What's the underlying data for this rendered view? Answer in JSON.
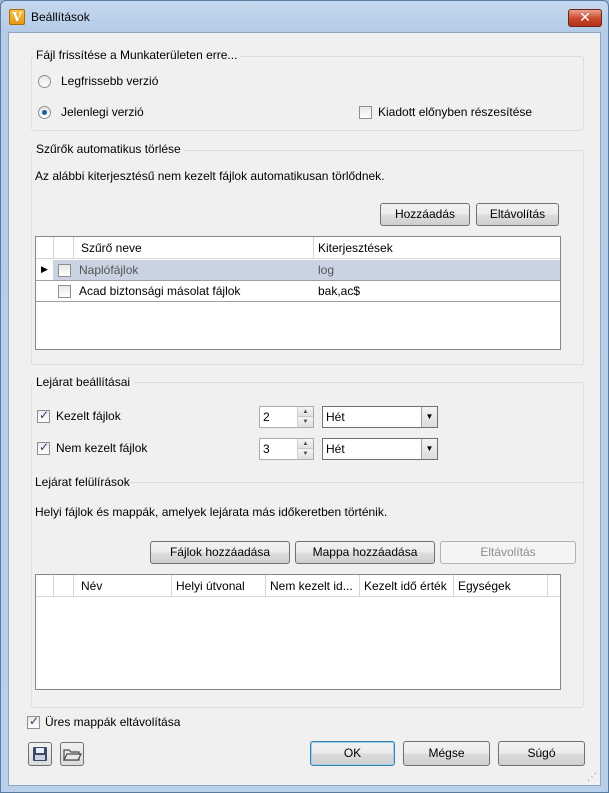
{
  "window": {
    "title": "Beállítások",
    "app_icon_letter": "V",
    "close_glyph": "✕"
  },
  "refresh": {
    "group_label": "Fájl frissítése a Munkaterületen erre...",
    "latest_label": "Legfrissebb verzió",
    "current_label": "Jelenlegi verzió",
    "prefer_released_label": "Kiadott előnyben részesítése",
    "selected": "current"
  },
  "auto_delete": {
    "group_label": "Szűrők automatikus törlése",
    "description": "Az alábbi kiterjesztésű nem kezelt fájlok automatikusan törlődnek.",
    "add_button": "Hozzáadás",
    "remove_button": "Eltávolítás",
    "columns": [
      "Szűrő neve",
      "Kiterjesztések"
    ],
    "rows": [
      {
        "name": "Naplófájlok",
        "ext": "log",
        "checked": false,
        "selected": true
      },
      {
        "name": "Acad biztonsági másolat fájlok",
        "ext": "bak,ac$",
        "checked": false,
        "selected": false
      }
    ]
  },
  "expiry": {
    "group_label": "Lejárat beállításai",
    "managed_label": "Kezelt fájlok",
    "managed_value": "2",
    "managed_unit": "Hét",
    "unmanaged_label": "Nem kezelt fájlok",
    "unmanaged_value": "3",
    "unmanaged_unit": "Hét"
  },
  "overrides": {
    "group_label": "Lejárat felülírások",
    "description": "Helyi fájlok és mappák, amelyek lejárata más időkeretben történik.",
    "add_files_button": "Fájlok hozzáadása",
    "add_folder_button": "Mappa hozzáadása",
    "remove_button": "Eltávolítás",
    "columns": [
      "Név",
      "Helyi útvonal",
      "Nem kezelt id...",
      "Kezelt idő érték",
      "Egységek"
    ]
  },
  "footer": {
    "remove_empty_label": "Üres mappák eltávolítása",
    "ok": "OK",
    "cancel": "Mégse",
    "help": "Súgó"
  },
  "colors": {
    "selected_row": "#c9d3e2",
    "accent": "#1f5aa8",
    "close": "#c8462c"
  }
}
